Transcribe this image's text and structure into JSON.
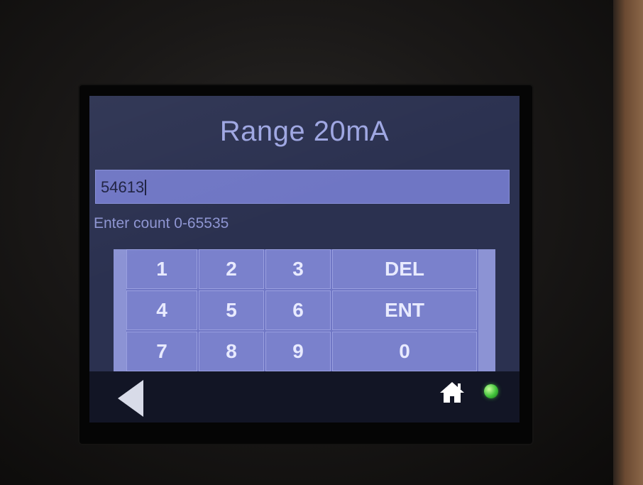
{
  "screen": {
    "title": "Range 20mA",
    "entry_value": "54613",
    "hint": "Enter count 0-65535"
  },
  "keypad": {
    "key_1": "1",
    "key_2": "2",
    "key_3": "3",
    "key_4": "4",
    "key_5": "5",
    "key_6": "6",
    "key_7": "7",
    "key_8": "8",
    "key_9": "9",
    "key_0": "0",
    "key_del": "DEL",
    "key_ent": "ENT"
  },
  "bottom_bar": {
    "back_icon": "back-arrow-icon",
    "home_icon": "home-icon",
    "status_led": "status-led-icon",
    "led_color": "#3fc23a"
  },
  "colors": {
    "screen_background": "#2b3150",
    "title_text": "#9ea6e2",
    "entry_background": "#6f76c4",
    "key_background": "#7a81cc"
  }
}
